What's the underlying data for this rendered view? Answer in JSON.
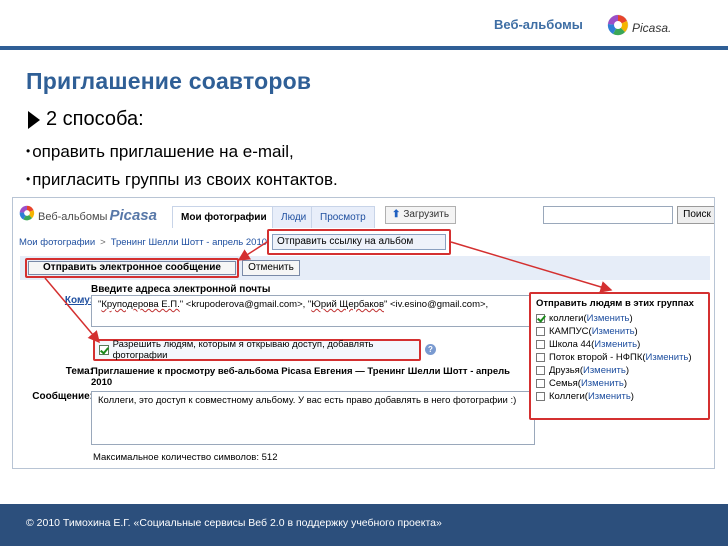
{
  "header": {
    "brand": "Веб-альбомы",
    "logo_text": "Picasa."
  },
  "slide": {
    "title": "Приглашение соавторов",
    "bullet_main": "2 способа:",
    "bullets": [
      "оправить приглашение на e-mail,",
      "пригласить группы из своих контактов."
    ]
  },
  "app": {
    "title_prefix": "Веб-альбомы",
    "title_brand": "Picasa",
    "tabs": [
      "Мои фотографии",
      "Люди",
      "Просмотр"
    ],
    "upload": "Загрузить",
    "search_button": "Поиск",
    "breadcrumb": {
      "root": "Мои фотографии",
      "sep": ">",
      "album": "Тренинг Шелли Шотт - апрель 2010",
      "sep2": ">"
    },
    "share_link_button": "Отправить ссылку на альбом",
    "send_email_button": "Отправить электронное сообщение",
    "cancel_button": "Отменить",
    "form_header": "Введите адреса электронной почты",
    "to_label": "Кому:",
    "recipients": {
      "r1_name": "Круподерова Е.П.",
      "r1_addr": "\" <krupoderova@gmail.com>, \"",
      "r2_name": "Юрий Щербаков",
      "r2_addr": "\" <iv.esino@gmail.com>,"
    },
    "allow_label": "Разрешить людям, которым я открываю доступ, добавлять фотографии",
    "subject_label": "Тема:",
    "subject": "Приглашение к просмотру веб-альбома Picasa Евгения — Тренинг Шелли Шотт - апрель 2010",
    "message_label": "Сообщение:",
    "message": "Коллеги, это доступ к совместному альбому. У вас есть право добавлять в него фотографии :)",
    "char_count": "Максимальное количество символов: 512",
    "groups_title": "Отправить людям в этих группах",
    "change_link": "Изменить",
    "groups": [
      {
        "name": "коллеги",
        "checked": true
      },
      {
        "name": "КАМПУС",
        "checked": false
      },
      {
        "name": "Школа 44",
        "checked": false
      },
      {
        "name": "Поток второй - НФПК",
        "checked": false
      },
      {
        "name": "Друзья",
        "checked": false
      },
      {
        "name": "Семья",
        "checked": false
      },
      {
        "name": "Коллеги",
        "checked": false
      }
    ]
  },
  "footer": {
    "text": "© 2010  Тимохина Е.Г.  «Социальные сервисы Веб 2.0 в поддержку учебного проекта»"
  },
  "colors": {
    "accent": "#2f5f96",
    "highlight": "#d43030",
    "link": "#2050a0",
    "footer_bg": "#2c4f7c"
  }
}
